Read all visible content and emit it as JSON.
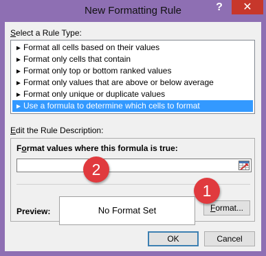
{
  "window": {
    "title": "New Formatting Rule",
    "help_glyph": "?",
    "close_glyph": "✕"
  },
  "rule_type": {
    "label_pre": "",
    "label_key": "S",
    "label_post": "elect a Rule Type:",
    "items": [
      {
        "label": "Format all cells based on their values",
        "selected": false
      },
      {
        "label": "Format only cells that contain",
        "selected": false
      },
      {
        "label": "Format only top or bottom ranked values",
        "selected": false
      },
      {
        "label": "Format only values that are above or below average",
        "selected": false
      },
      {
        "label": "Format only unique or duplicate values",
        "selected": false
      },
      {
        "label": "Use a formula to determine which cells to format",
        "selected": true
      }
    ],
    "item_glyph": "►"
  },
  "description": {
    "label_pre": "",
    "label_key": "E",
    "label_post": "dit the Rule Description:",
    "formula_label_pre": "F",
    "formula_label_key": "o",
    "formula_label_post": "rmat values where this formula is true:",
    "formula_value": ""
  },
  "preview": {
    "label": "Preview:",
    "text": "No Format Set"
  },
  "buttons": {
    "format_pre": "",
    "format_key": "F",
    "format_post": "ormat...",
    "ok": "OK",
    "cancel": "Cancel"
  },
  "annotations": {
    "badge_1": "1",
    "badge_2": "2",
    "color": "#e03a3e"
  }
}
